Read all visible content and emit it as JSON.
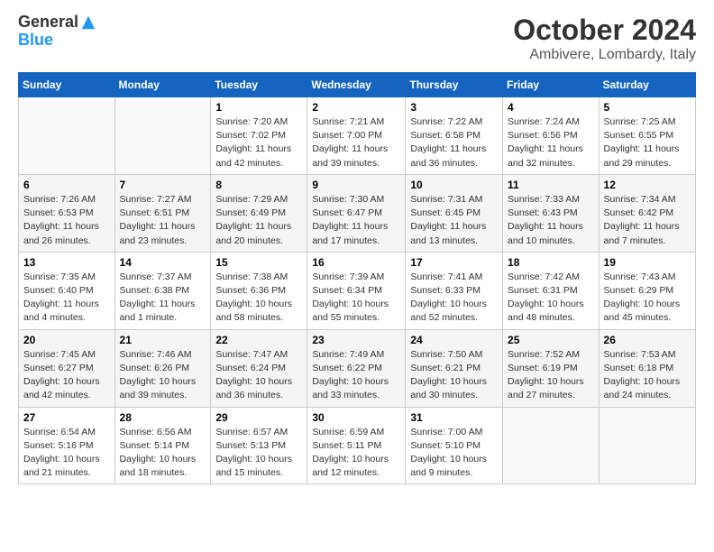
{
  "logo": {
    "line1": "General",
    "line2": "Blue"
  },
  "title": "October 2024",
  "subtitle": "Ambivere, Lombardy, Italy",
  "days_of_week": [
    "Sunday",
    "Monday",
    "Tuesday",
    "Wednesday",
    "Thursday",
    "Friday",
    "Saturday"
  ],
  "weeks": [
    [
      {
        "day": "",
        "info": ""
      },
      {
        "day": "",
        "info": ""
      },
      {
        "day": "1",
        "info": "Sunrise: 7:20 AM\nSunset: 7:02 PM\nDaylight: 11 hours and 42 minutes."
      },
      {
        "day": "2",
        "info": "Sunrise: 7:21 AM\nSunset: 7:00 PM\nDaylight: 11 hours and 39 minutes."
      },
      {
        "day": "3",
        "info": "Sunrise: 7:22 AM\nSunset: 6:58 PM\nDaylight: 11 hours and 36 minutes."
      },
      {
        "day": "4",
        "info": "Sunrise: 7:24 AM\nSunset: 6:56 PM\nDaylight: 11 hours and 32 minutes."
      },
      {
        "day": "5",
        "info": "Sunrise: 7:25 AM\nSunset: 6:55 PM\nDaylight: 11 hours and 29 minutes."
      }
    ],
    [
      {
        "day": "6",
        "info": "Sunrise: 7:26 AM\nSunset: 6:53 PM\nDaylight: 11 hours and 26 minutes."
      },
      {
        "day": "7",
        "info": "Sunrise: 7:27 AM\nSunset: 6:51 PM\nDaylight: 11 hours and 23 minutes."
      },
      {
        "day": "8",
        "info": "Sunrise: 7:29 AM\nSunset: 6:49 PM\nDaylight: 11 hours and 20 minutes."
      },
      {
        "day": "9",
        "info": "Sunrise: 7:30 AM\nSunset: 6:47 PM\nDaylight: 11 hours and 17 minutes."
      },
      {
        "day": "10",
        "info": "Sunrise: 7:31 AM\nSunset: 6:45 PM\nDaylight: 11 hours and 13 minutes."
      },
      {
        "day": "11",
        "info": "Sunrise: 7:33 AM\nSunset: 6:43 PM\nDaylight: 11 hours and 10 minutes."
      },
      {
        "day": "12",
        "info": "Sunrise: 7:34 AM\nSunset: 6:42 PM\nDaylight: 11 hours and 7 minutes."
      }
    ],
    [
      {
        "day": "13",
        "info": "Sunrise: 7:35 AM\nSunset: 6:40 PM\nDaylight: 11 hours and 4 minutes."
      },
      {
        "day": "14",
        "info": "Sunrise: 7:37 AM\nSunset: 6:38 PM\nDaylight: 11 hours and 1 minute."
      },
      {
        "day": "15",
        "info": "Sunrise: 7:38 AM\nSunset: 6:36 PM\nDaylight: 10 hours and 58 minutes."
      },
      {
        "day": "16",
        "info": "Sunrise: 7:39 AM\nSunset: 6:34 PM\nDaylight: 10 hours and 55 minutes."
      },
      {
        "day": "17",
        "info": "Sunrise: 7:41 AM\nSunset: 6:33 PM\nDaylight: 10 hours and 52 minutes."
      },
      {
        "day": "18",
        "info": "Sunrise: 7:42 AM\nSunset: 6:31 PM\nDaylight: 10 hours and 48 minutes."
      },
      {
        "day": "19",
        "info": "Sunrise: 7:43 AM\nSunset: 6:29 PM\nDaylight: 10 hours and 45 minutes."
      }
    ],
    [
      {
        "day": "20",
        "info": "Sunrise: 7:45 AM\nSunset: 6:27 PM\nDaylight: 10 hours and 42 minutes."
      },
      {
        "day": "21",
        "info": "Sunrise: 7:46 AM\nSunset: 6:26 PM\nDaylight: 10 hours and 39 minutes."
      },
      {
        "day": "22",
        "info": "Sunrise: 7:47 AM\nSunset: 6:24 PM\nDaylight: 10 hours and 36 minutes."
      },
      {
        "day": "23",
        "info": "Sunrise: 7:49 AM\nSunset: 6:22 PM\nDaylight: 10 hours and 33 minutes."
      },
      {
        "day": "24",
        "info": "Sunrise: 7:50 AM\nSunset: 6:21 PM\nDaylight: 10 hours and 30 minutes."
      },
      {
        "day": "25",
        "info": "Sunrise: 7:52 AM\nSunset: 6:19 PM\nDaylight: 10 hours and 27 minutes."
      },
      {
        "day": "26",
        "info": "Sunrise: 7:53 AM\nSunset: 6:18 PM\nDaylight: 10 hours and 24 minutes."
      }
    ],
    [
      {
        "day": "27",
        "info": "Sunrise: 6:54 AM\nSunset: 5:16 PM\nDaylight: 10 hours and 21 minutes."
      },
      {
        "day": "28",
        "info": "Sunrise: 6:56 AM\nSunset: 5:14 PM\nDaylight: 10 hours and 18 minutes."
      },
      {
        "day": "29",
        "info": "Sunrise: 6:57 AM\nSunset: 5:13 PM\nDaylight: 10 hours and 15 minutes."
      },
      {
        "day": "30",
        "info": "Sunrise: 6:59 AM\nSunset: 5:11 PM\nDaylight: 10 hours and 12 minutes."
      },
      {
        "day": "31",
        "info": "Sunrise: 7:00 AM\nSunset: 5:10 PM\nDaylight: 10 hours and 9 minutes."
      },
      {
        "day": "",
        "info": ""
      },
      {
        "day": "",
        "info": ""
      }
    ]
  ],
  "colors": {
    "header_bg": "#1565C0",
    "header_text": "#ffffff",
    "row_even": "#f5f5f5",
    "row_odd": "#ffffff"
  }
}
